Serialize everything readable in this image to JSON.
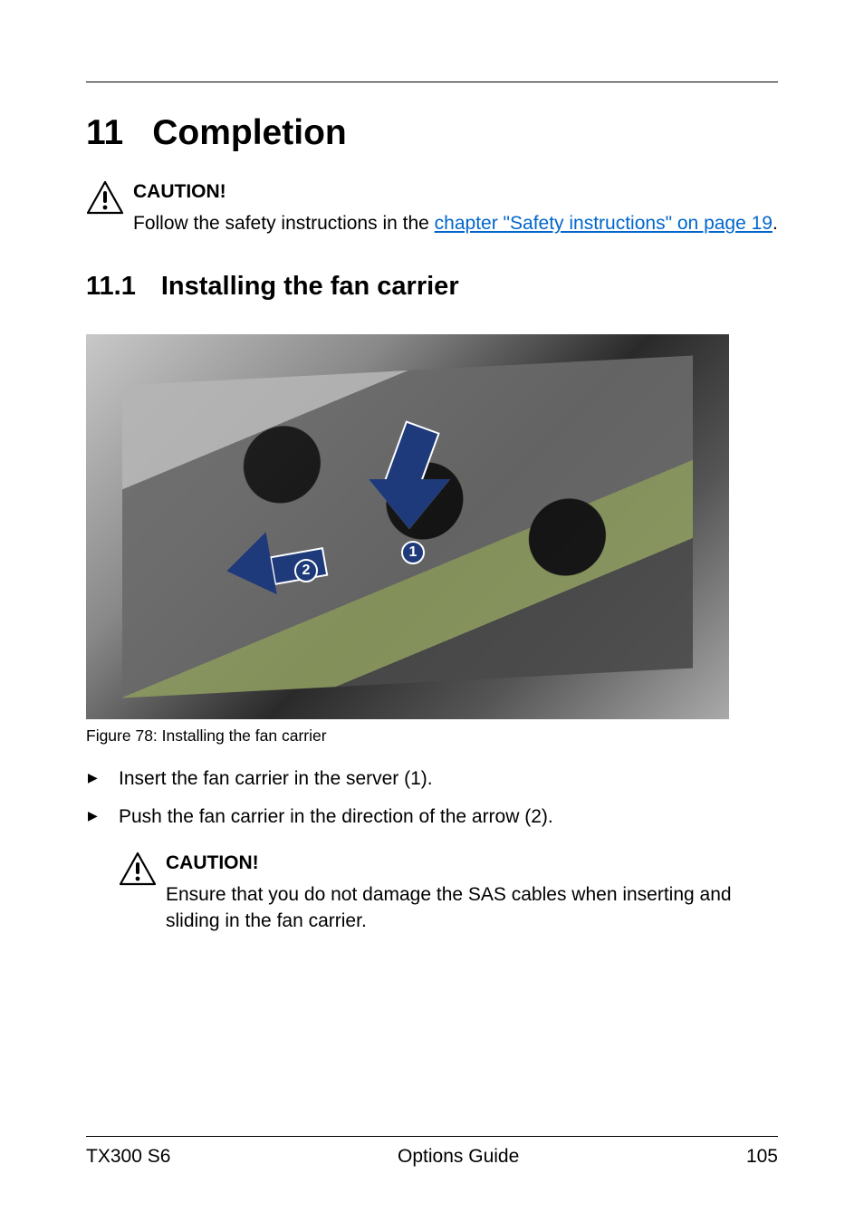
{
  "chapter": {
    "number": "11",
    "title": "Completion"
  },
  "caution1": {
    "label": "CAUTION!",
    "text_before_link": "Follow the safety instructions in the ",
    "link_text": "chapter \"Safety instructions\" on page 19",
    "text_after_link": "."
  },
  "section": {
    "number": "11.1",
    "title": "Installing the fan carrier"
  },
  "figure": {
    "caption": "Figure 78: Installing the fan carrier",
    "marker1": "1",
    "marker2": "2"
  },
  "steps": [
    "Insert the fan carrier in the server (1).",
    "Push the fan carrier in the direction of the arrow (2)."
  ],
  "caution2": {
    "label": "CAUTION!",
    "text": "Ensure that you do not damage the SAS cables when inserting and sliding in the fan carrier."
  },
  "footer": {
    "left": "TX300 S6",
    "center": "Options Guide",
    "right": "105"
  }
}
